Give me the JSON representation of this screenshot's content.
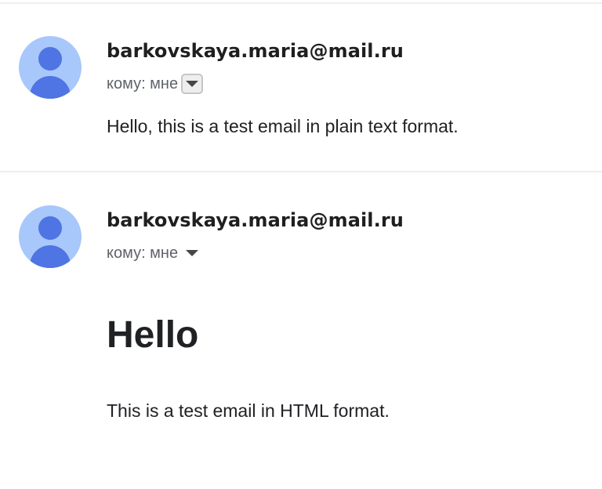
{
  "messages": [
    {
      "sender": "barkovskaya.maria@mail.ru",
      "recipient": "кому: мне",
      "body_text": "Hello, this is a test email in plain text format."
    },
    {
      "sender": "barkovskaya.maria@mail.ru",
      "recipient": "кому: мне",
      "heading": "Hello",
      "body_text": "This is a test email in HTML format."
    }
  ],
  "colors": {
    "avatar_background": "#a8c7fa",
    "avatar_figure": "#4f74e3",
    "divider": "#eeeeee",
    "text_primary": "#202124",
    "text_secondary": "#5f6368"
  },
  "icons": {
    "avatar": "person-avatar-icon",
    "details_toggle": "caret-down-icon"
  }
}
